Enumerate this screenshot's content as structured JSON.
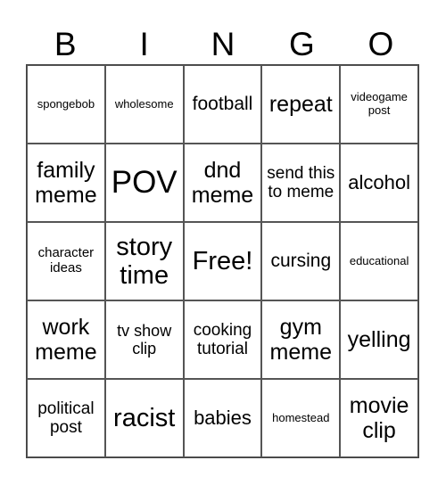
{
  "header": {
    "letters": [
      "B",
      "I",
      "N",
      "G",
      "O"
    ]
  },
  "cells": [
    {
      "text": "spongebob",
      "size": 13
    },
    {
      "text": "wholesome",
      "size": 13
    },
    {
      "text": "football",
      "size": 21
    },
    {
      "text": "repeat",
      "size": 25
    },
    {
      "text": "videogame post",
      "size": 13
    },
    {
      "text": "family meme",
      "size": 25
    },
    {
      "text": "POV",
      "size": 35
    },
    {
      "text": "dnd meme",
      "size": 25
    },
    {
      "text": "send this to meme",
      "size": 19
    },
    {
      "text": "alcohol",
      "size": 22
    },
    {
      "text": "character ideas",
      "size": 15
    },
    {
      "text": "story time",
      "size": 29
    },
    {
      "text": "Free!",
      "size": 29
    },
    {
      "text": "cursing",
      "size": 21
    },
    {
      "text": "educational",
      "size": 13
    },
    {
      "text": "work meme",
      "size": 25
    },
    {
      "text": "tv show clip",
      "size": 18
    },
    {
      "text": "cooking tutorial",
      "size": 19
    },
    {
      "text": "gym meme",
      "size": 25
    },
    {
      "text": "yelling",
      "size": 25
    },
    {
      "text": "political post",
      "size": 19
    },
    {
      "text": "racist",
      "size": 29
    },
    {
      "text": "babies",
      "size": 22
    },
    {
      "text": "homestead",
      "size": 13
    },
    {
      "text": "movie clip",
      "size": 25
    }
  ]
}
